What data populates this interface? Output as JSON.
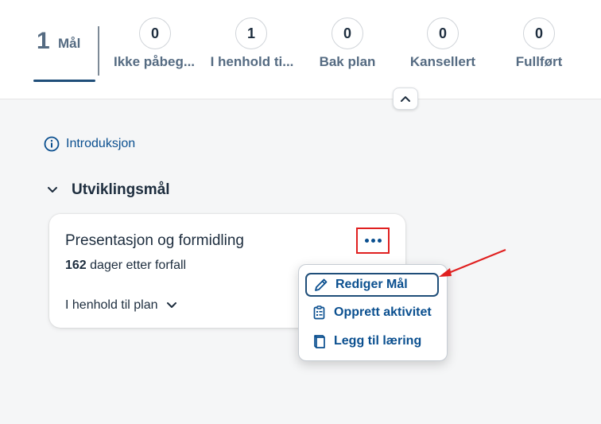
{
  "tabs": {
    "main": {
      "count": "1",
      "label": "Mål"
    },
    "status": [
      {
        "count": "0",
        "label": "Ikke påbeg..."
      },
      {
        "count": "1",
        "label": "I henhold ti..."
      },
      {
        "count": "0",
        "label": "Bak plan"
      },
      {
        "count": "0",
        "label": "Kansellert"
      },
      {
        "count": "0",
        "label": "Fullført"
      }
    ]
  },
  "intro": {
    "label": "Introduksjon",
    "icon": "info-icon"
  },
  "section": {
    "title": "Utviklingsmål",
    "icon": "chevron-down-icon"
  },
  "goal": {
    "title": "Presentasjon og formidling",
    "days": "162",
    "due_text": " dager etter forfall",
    "status": "I henhold til plan"
  },
  "menu": {
    "items": [
      {
        "label": "Rediger Mål",
        "icon": "pencil-icon"
      },
      {
        "label": "Opprett aktivitet",
        "icon": "clipboard-icon"
      },
      {
        "label": "Legg til læring",
        "icon": "book-icon"
      }
    ]
  },
  "colors": {
    "accent": "#0a4f8f",
    "highlight": "#e02020",
    "background": "#f5f6f7"
  }
}
